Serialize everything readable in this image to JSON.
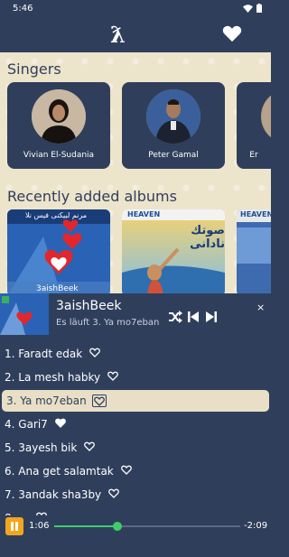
{
  "status": {
    "time": "5:46"
  },
  "app": {
    "logo_glyph": "ƛ"
  },
  "singers": {
    "title": "Singers",
    "items": [
      {
        "name": "Vivian El-Sudania"
      },
      {
        "name": "Peter Gamal"
      },
      {
        "name": "Er"
      }
    ]
  },
  "albums": {
    "title": "Recently added albums",
    "items": [
      {
        "cover_top": "مرنم لبيكنى فيس نلا",
        "cover_bottom": "3aishBeek"
      },
      {
        "cover_badge": "HEAVEN",
        "cover_title": "صوتك نادانى"
      },
      {
        "cover_badge": "HEAVEN"
      }
    ]
  },
  "player": {
    "title": "3aishBeek",
    "subtitle": "Es läuft 3. Ya mo7eban",
    "close": "×",
    "tracks": [
      {
        "label": "1. Faradt edak",
        "liked": false
      },
      {
        "label": "2. La mesh habky",
        "liked": false
      },
      {
        "label": "3. Ya mo7eban",
        "liked": false,
        "active": true
      },
      {
        "label": "4. Gari7",
        "liked": true
      },
      {
        "label": "5. 3ayesh bik",
        "liked": false
      },
      {
        "label": "6. Ana get salamtak",
        "liked": false
      },
      {
        "label": "7. 3andak sha3by",
        "liked": false
      },
      {
        "label": "8. ...",
        "liked": false
      }
    ],
    "time_current": "1:06",
    "time_remaining": "-2:09",
    "progress": 0.34
  },
  "colors": {
    "primary": "#2f3f5b",
    "background": "#ede4cc",
    "accent": "#3ecf6a",
    "pause": "#f2a61e"
  }
}
